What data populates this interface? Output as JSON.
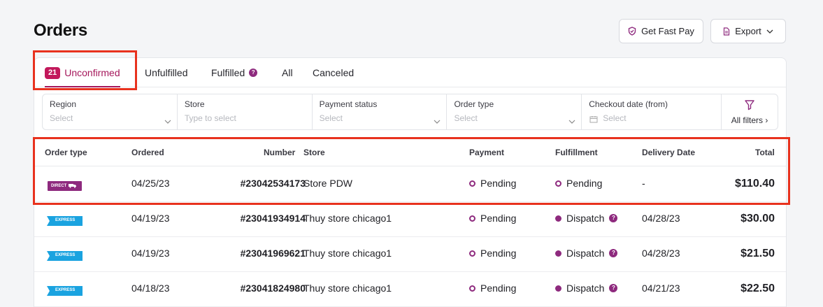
{
  "page": {
    "title": "Orders"
  },
  "header": {
    "fast_pay_label": "Get Fast Pay",
    "export_label": "Export"
  },
  "tabs": [
    {
      "label": "Unconfirmed",
      "count": "21",
      "active": true
    },
    {
      "label": "Unfulfilled"
    },
    {
      "label": "Fulfilled",
      "help": "?"
    },
    {
      "label": "All"
    },
    {
      "label": "Canceled"
    }
  ],
  "filters": [
    {
      "label": "Region",
      "placeholder": "Select"
    },
    {
      "label": "Store",
      "placeholder": "Type to select"
    },
    {
      "label": "Payment status",
      "placeholder": "Select"
    },
    {
      "label": "Order type",
      "placeholder": "Select"
    },
    {
      "label": "Checkout date (from)",
      "placeholder": "Select"
    }
  ],
  "all_filters_label": "All filters ›",
  "table": {
    "columns": [
      "Order type",
      "Ordered",
      "Number",
      "Store",
      "Payment",
      "Fulfillment",
      "Delivery Date",
      "Total"
    ],
    "rows": [
      {
        "order_type": "DIRECT",
        "ordered": "04/25/23",
        "number": "#23042534173",
        "store": "Store PDW",
        "payment": "Pending",
        "fulfillment": "Pending",
        "delivery": "-",
        "total": "$110.40"
      },
      {
        "order_type": "EXPRESS",
        "ordered": "04/19/23",
        "number": "#23041934914",
        "store": "Thuy store chicago1",
        "payment": "Pending",
        "fulfillment": "Dispatch",
        "delivery": "04/28/23",
        "total": "$30.00"
      },
      {
        "order_type": "EXPRESS",
        "ordered": "04/19/23",
        "number": "#23041969621",
        "store": "Thuy store chicago1",
        "payment": "Pending",
        "fulfillment": "Dispatch",
        "delivery": "04/28/23",
        "total": "$21.50"
      },
      {
        "order_type": "EXPRESS",
        "ordered": "04/18/23",
        "number": "#23041824980",
        "store": "Thuy store chicago1",
        "payment": "Pending",
        "fulfillment": "Dispatch",
        "delivery": "04/21/23",
        "total": "$22.50"
      }
    ]
  },
  "colors": {
    "accent": "#a5175b",
    "badge": "#c2185b",
    "purple": "#8e2a7e",
    "express": "#1aa3e0",
    "highlight": "#e8321e"
  }
}
